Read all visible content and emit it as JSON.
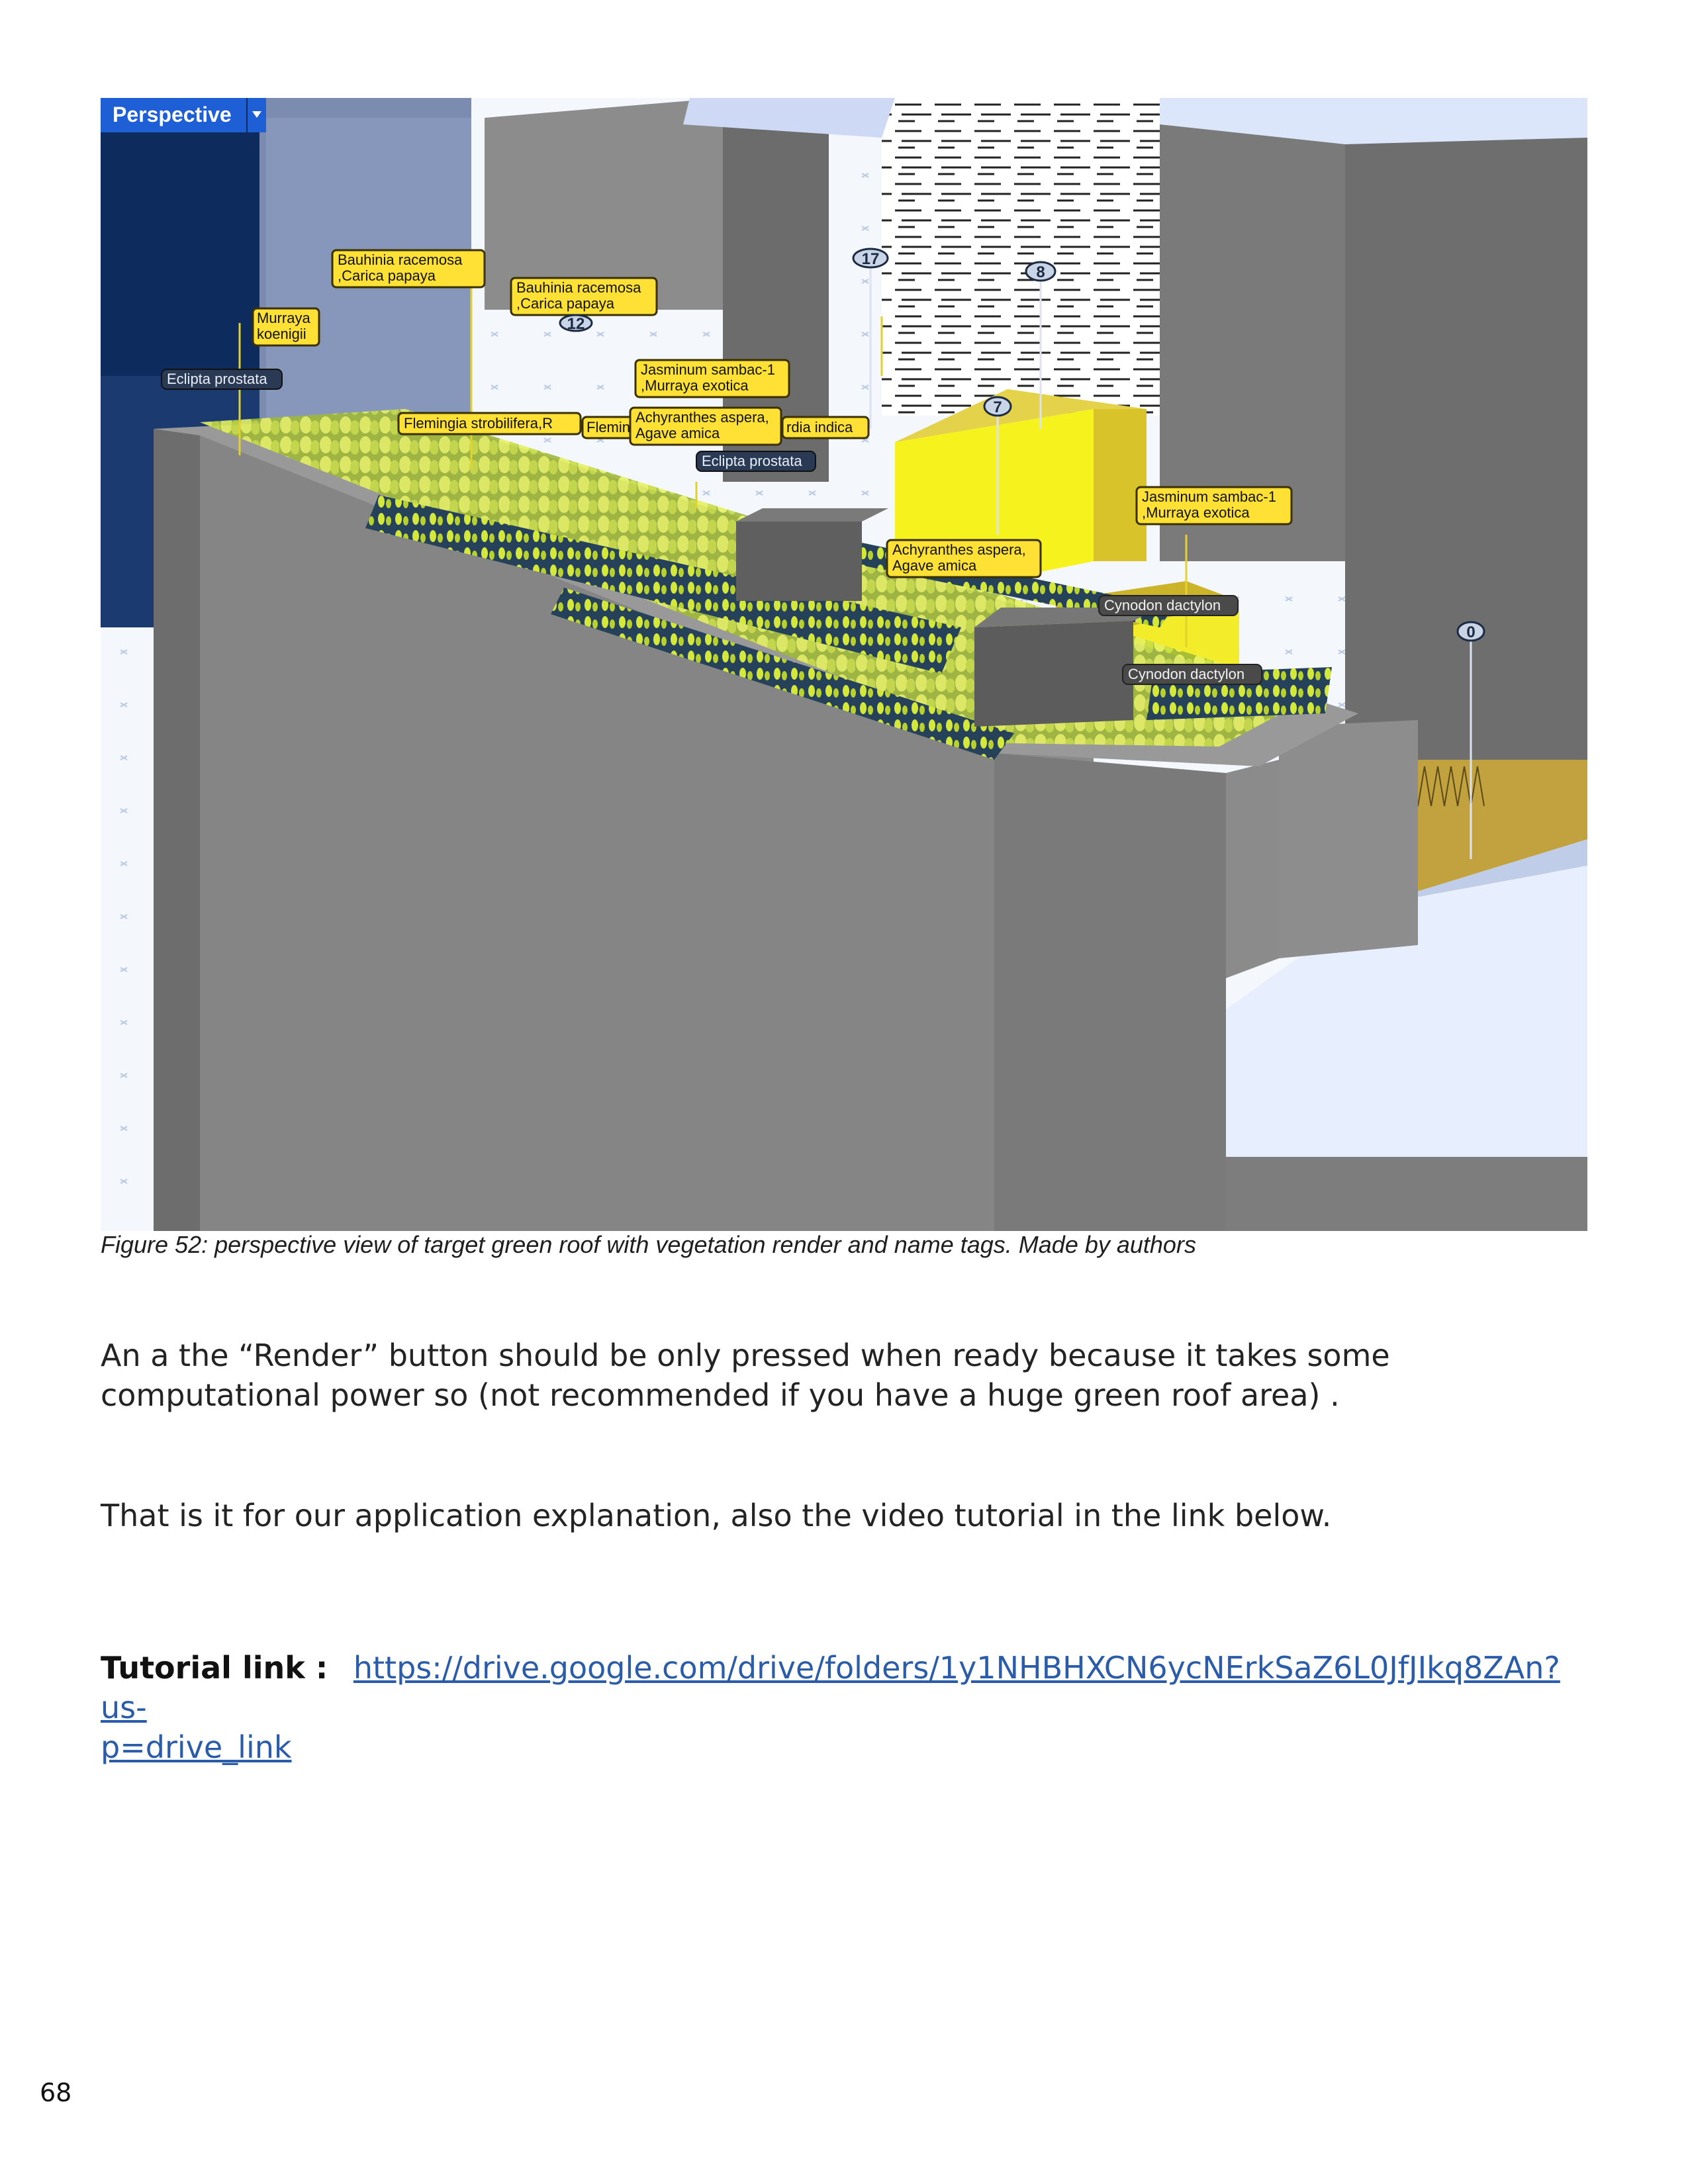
{
  "viewport": {
    "label": "Perspective",
    "colors": {
      "label_bg": "#1f5fd6",
      "wall": "#8a8a8a",
      "roof_yellow": "#f4ef3a",
      "sky": "#dfe8fb"
    },
    "tags": [
      {
        "lines": [
          "Bauhinia racemosa",
          ",Carica papaya"
        ]
      },
      {
        "lines": [
          "Bauhinia racemosa",
          ",Carica papaya"
        ]
      },
      {
        "lines": [
          "Murraya",
          "koenigii"
        ]
      },
      {
        "lines": [
          "Jasminum sambac-1",
          ",Murraya exotica"
        ]
      },
      {
        "lines": [
          "Flemingia strobilifera,R"
        ]
      },
      {
        "lines": [
          "Flemin"
        ]
      },
      {
        "lines": [
          "Achyranthes aspera,",
          "Agave amica"
        ]
      },
      {
        "lines": [
          "rdia indica"
        ]
      },
      {
        "lines": [
          "Jasminum sambac-1",
          ",Murraya exotica"
        ]
      },
      {
        "lines": [
          "Achyranthes aspera,",
          "Agave amica"
        ]
      }
    ],
    "gray_tags": [
      {
        "text": "Eclipta prostata"
      },
      {
        "text": "Eclipta prostata"
      },
      {
        "text": "Cynodon dactylon"
      },
      {
        "text": "Cynodon dactylon"
      }
    ],
    "markers": [
      "17",
      "8",
      "12",
      "7",
      "0"
    ]
  },
  "caption": "Figure 52: perspective view of target green roof with vegetation render and name tags. Made by authors",
  "paragraphs": [
    " An a the “Render” button should be only pressed when ready because it takes some computational power so (not recommended if you have a huge green roof area) .",
    "That is it for our application explanation, also the video tutorial in the link below."
  ],
  "tutorial": {
    "label": "Tutorial link :",
    "url": "https://drive.google.com/drive/folders/1y1NHBHXCN6ycNErkSaZ6L0JfJIkq8ZAn?usp=drive_link",
    "url_line1": "https://drive.google.com/drive/folders/1y1NHBHXCN6ycNErkSaZ6L0JfJIkq8ZAn?us-",
    "url_line2": "p=drive_link"
  },
  "page_number": "68"
}
